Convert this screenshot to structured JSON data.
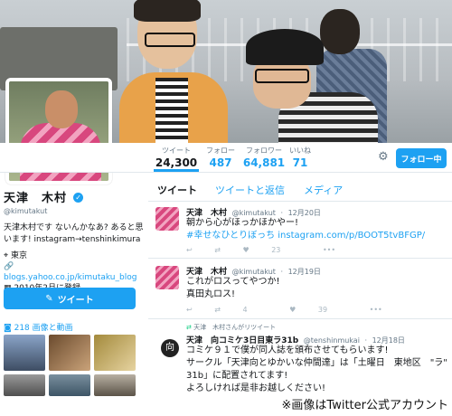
{
  "profile": {
    "name": "天津　木村",
    "handle": "@kimutakut",
    "bio": "天津木村です ないんかなあ? あると思います! instagram→tenshinkimura",
    "location": "東京",
    "website": "blogs.yahoo.co.jp/kimutaku_blog",
    "joined": "2010年2月に登録"
  },
  "stats": [
    {
      "label": "ツイート",
      "value": "24,300"
    },
    {
      "label": "フォロー",
      "value": "487"
    },
    {
      "label": "フォロワー",
      "value": "64,881"
    },
    {
      "label": "いいね",
      "value": "71"
    }
  ],
  "buttons": {
    "follow": "フォロー中",
    "tweet": "ツイート"
  },
  "media": {
    "label": "218 画像と動画"
  },
  "tabs": [
    {
      "label": "ツイート"
    },
    {
      "label": "ツイートと返信"
    },
    {
      "label": "メディア"
    }
  ],
  "tweets": [
    {
      "name": "天津　木村",
      "handle": "@kimutakut",
      "date": "12月20日",
      "line1": "朝から心がほっかほかやー!",
      "hashtag": "#幸せなひとりぼっち",
      "link": "instagram.com/p/BOOT5tvBFGP/",
      "retweets": "",
      "likes": "23"
    },
    {
      "name": "天津　木村",
      "handle": "@kimutakut",
      "date": "12月19日",
      "line1": "これがロスってやつか!",
      "line2": "真田丸ロス!",
      "retweets": "4",
      "likes": "39"
    },
    {
      "rt_label": "天津　木村さんがリツイート",
      "name": "天津　向コミケ3日目東ラ31b",
      "handle": "@tenshinmukai",
      "date": "12月18日",
      "shop_icon": "向",
      "line1": "コミケ９１で僕が同人誌を頒布させてもらいます!",
      "line2": "サークル「天津向とゆかいな仲間達」は「土曜日　東地区　\"ラ\"　31b」に配置されてます!",
      "line3": "よろしければ是非お越しください!"
    }
  ],
  "credit": "※画像はTwitter公式アカウント",
  "colors": {
    "accent": "#1da1f2",
    "text": "#14171a",
    "muted": "#657786"
  }
}
